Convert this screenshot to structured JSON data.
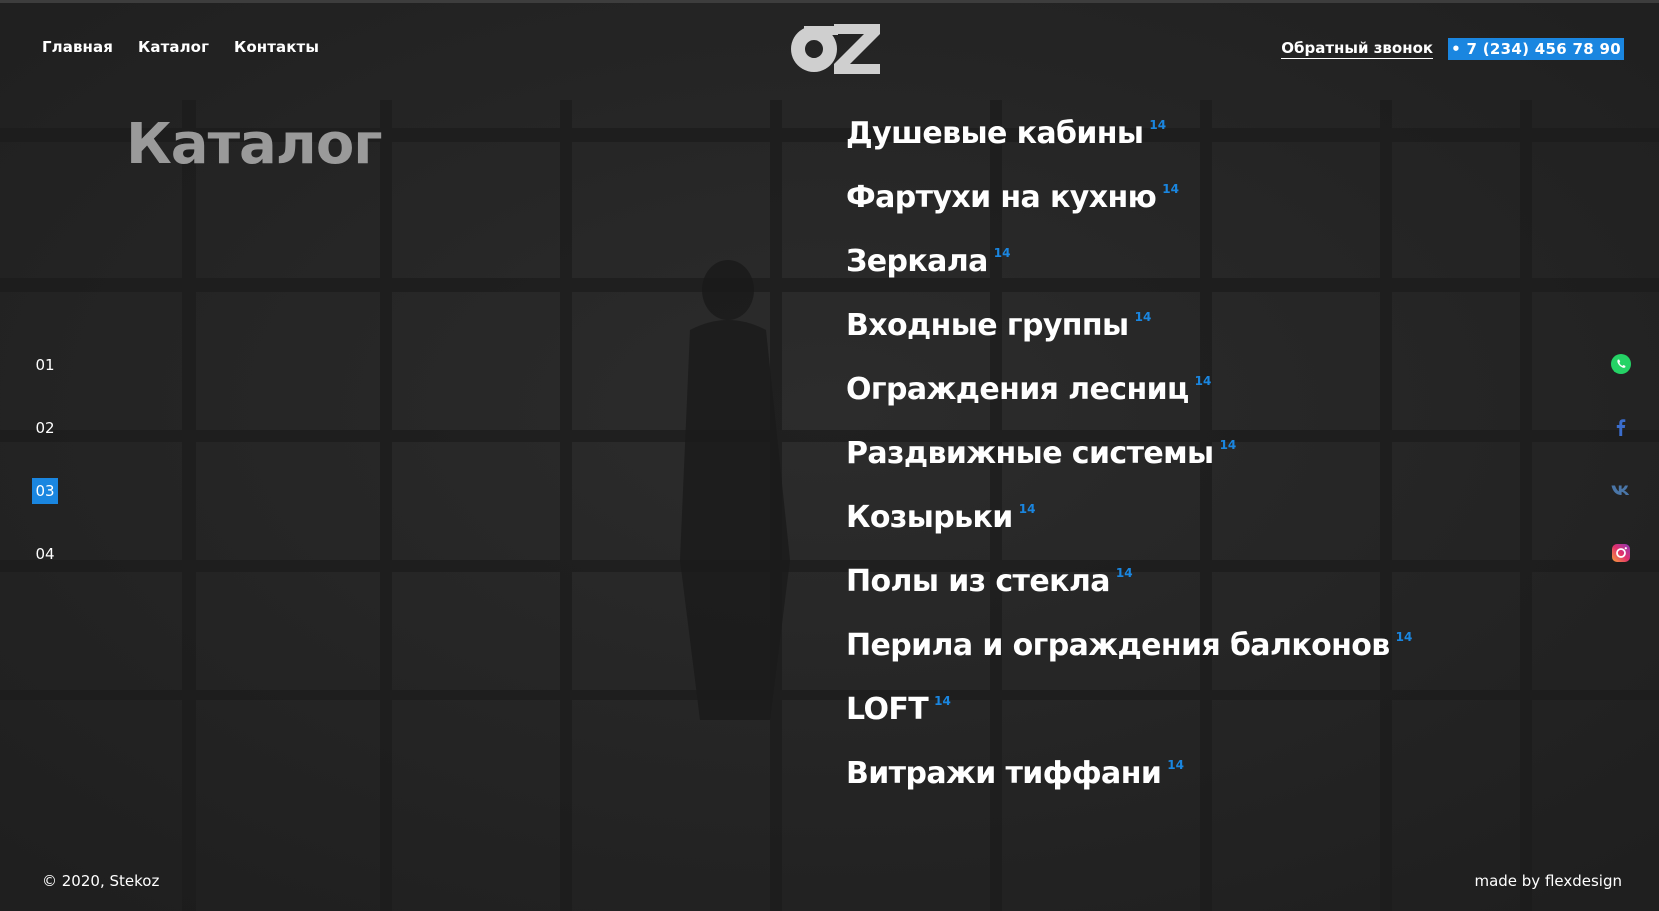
{
  "header": {
    "nav": [
      {
        "label": "Главная"
      },
      {
        "label": "Каталог"
      },
      {
        "label": "Контакты"
      }
    ],
    "logo_text": "OZ",
    "callback_label": "Обратный звонок",
    "phone": "• 7 (234) 456 78 90"
  },
  "main": {
    "title": "Каталог",
    "pager": [
      {
        "label": "01",
        "active": false
      },
      {
        "label": "02",
        "active": false
      },
      {
        "label": "03",
        "active": true
      },
      {
        "label": "04",
        "active": false
      }
    ],
    "catalog": [
      {
        "label": "Душевые кабины",
        "count": "14"
      },
      {
        "label": "Фартухи на кухню",
        "count": "14"
      },
      {
        "label": "Зеркала",
        "count": "14"
      },
      {
        "label": "Входные группы",
        "count": "14"
      },
      {
        "label": "Ограждения лесниц",
        "count": "14"
      },
      {
        "label": "Раздвижные системы",
        "count": "14"
      },
      {
        "label": "Козырьки",
        "count": "14"
      },
      {
        "label": "Полы из стекла",
        "count": "14"
      },
      {
        "label": "Перила и ограждения балконов",
        "count": "14"
      },
      {
        "label": "LOFT",
        "count": "14"
      },
      {
        "label": "Витражи тиффани",
        "count": "14"
      }
    ]
  },
  "social": [
    {
      "icon": "whatsapp-icon",
      "color": "#25d366"
    },
    {
      "icon": "facebook-icon",
      "color": "#3b6dcc"
    },
    {
      "icon": "vk-icon",
      "color": "#4a76a8"
    },
    {
      "icon": "instagram-icon",
      "color": "#e1306c"
    }
  ],
  "footer": {
    "copyright": "© 2020, Stekoz",
    "credits": "made by flexdesign"
  },
  "colors": {
    "accent": "#1a86e0",
    "title_gray": "#9a9a9a",
    "background": "#262626"
  }
}
